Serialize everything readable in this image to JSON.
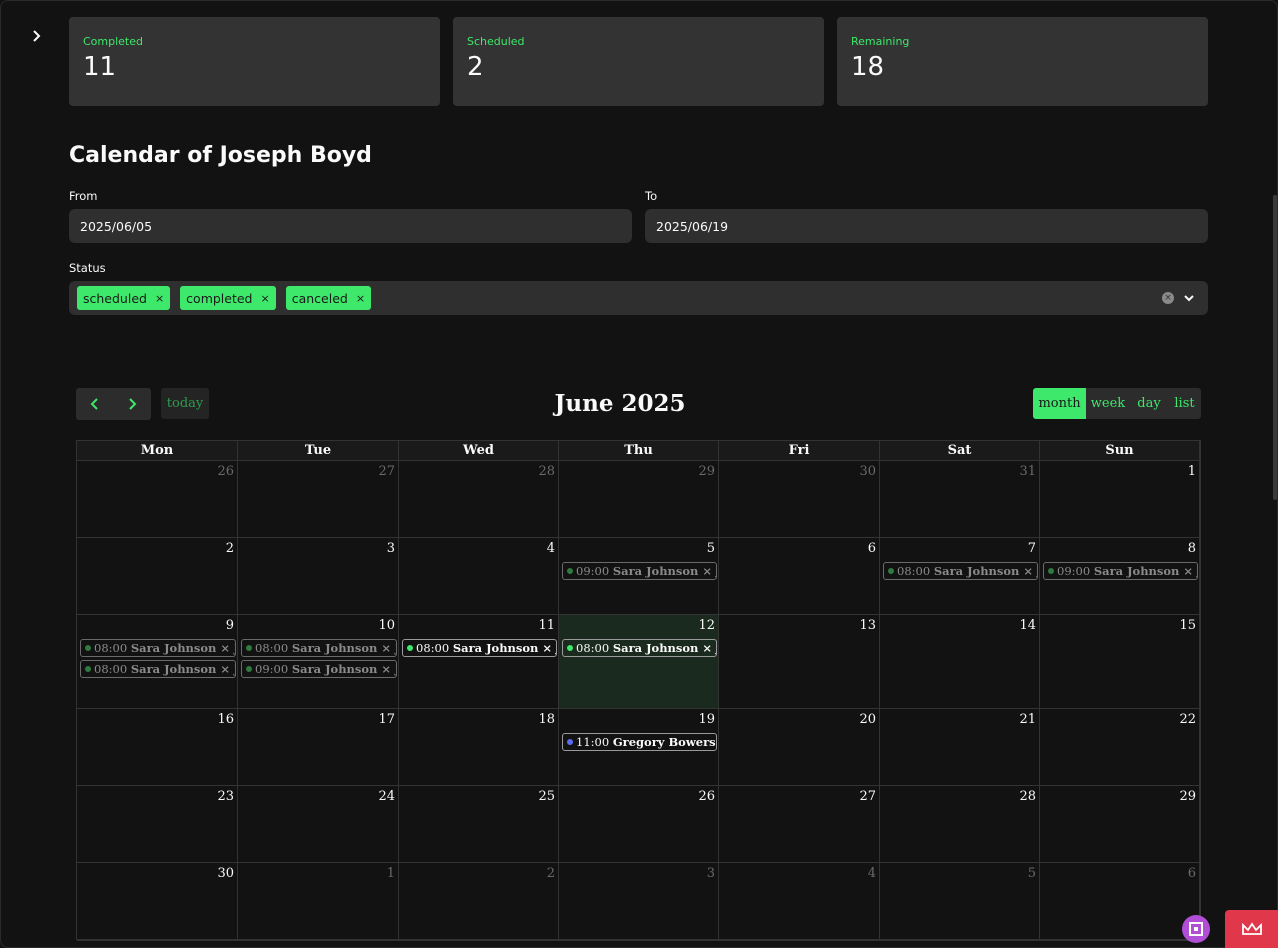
{
  "metrics": [
    {
      "label": "Completed",
      "value": "11"
    },
    {
      "label": "Scheduled",
      "value": "2"
    },
    {
      "label": "Remaining",
      "value": "18"
    }
  ],
  "page_title": "Calendar of Joseph Boyd",
  "filters": {
    "from_label": "From",
    "from_value": "2025/06/05",
    "to_label": "To",
    "to_value": "2025/06/19",
    "status_label": "Status",
    "status_chips": [
      "scheduled",
      "completed",
      "canceled"
    ],
    "chip_remove_glyph": "×"
  },
  "calendar": {
    "today_label": "today",
    "title": "June 2025",
    "views": [
      "month",
      "week",
      "day",
      "list"
    ],
    "active_view": "month",
    "weekdays": [
      "Mon",
      "Tue",
      "Wed",
      "Thu",
      "Fri",
      "Sat",
      "Sun"
    ],
    "weeks": [
      [
        "26",
        "27",
        "28",
        "29",
        "30",
        "31",
        "1"
      ],
      [
        "2",
        "3",
        "4",
        "5",
        "6",
        "7",
        "8"
      ],
      [
        "9",
        "10",
        "11",
        "12",
        "13",
        "14",
        "15"
      ],
      [
        "16",
        "17",
        "18",
        "19",
        "20",
        "21",
        "22"
      ],
      [
        "23",
        "24",
        "25",
        "26",
        "27",
        "28",
        "29"
      ],
      [
        "30",
        "1",
        "2",
        "3",
        "4",
        "5",
        "6"
      ]
    ],
    "events": {
      "w1d3": [
        {
          "time": "09:00",
          "title": "Sara Johnson × Joseph Boyd"
        }
      ],
      "w1d5": [
        {
          "time": "08:00",
          "title": "Sara Johnson × Joseph Boyd"
        }
      ],
      "w1d6": [
        {
          "time": "09:00",
          "title": "Sara Johnson × Joseph Boyd"
        }
      ],
      "w2d0": [
        {
          "time": "08:00",
          "title": "Sara Johnson × Joseph Boyd"
        },
        {
          "time": "08:00",
          "title": "Sara Johnson × Joseph Boyd"
        }
      ],
      "w2d1": [
        {
          "time": "08:00",
          "title": "Sara Johnson × Joseph Boyd"
        },
        {
          "time": "09:00",
          "title": "Sara Johnson × Joseph Boyd"
        }
      ],
      "w2d2": [
        {
          "time": "08:00",
          "title": "Sara Johnson × Joseph Boyd"
        }
      ],
      "w2d3": [
        {
          "time": "08:00",
          "title": "Sara Johnson × Joseph Boyd"
        }
      ],
      "w3d3": [
        {
          "time": "11:00",
          "title": "Gregory Bowers × Joseph Boyd"
        }
      ]
    },
    "colors": {
      "completed_dot": "#2f7a3e",
      "scheduled_dot": "#3ee86a",
      "other_dot": "#5b6cf0",
      "accent": "#3ee86a"
    }
  }
}
